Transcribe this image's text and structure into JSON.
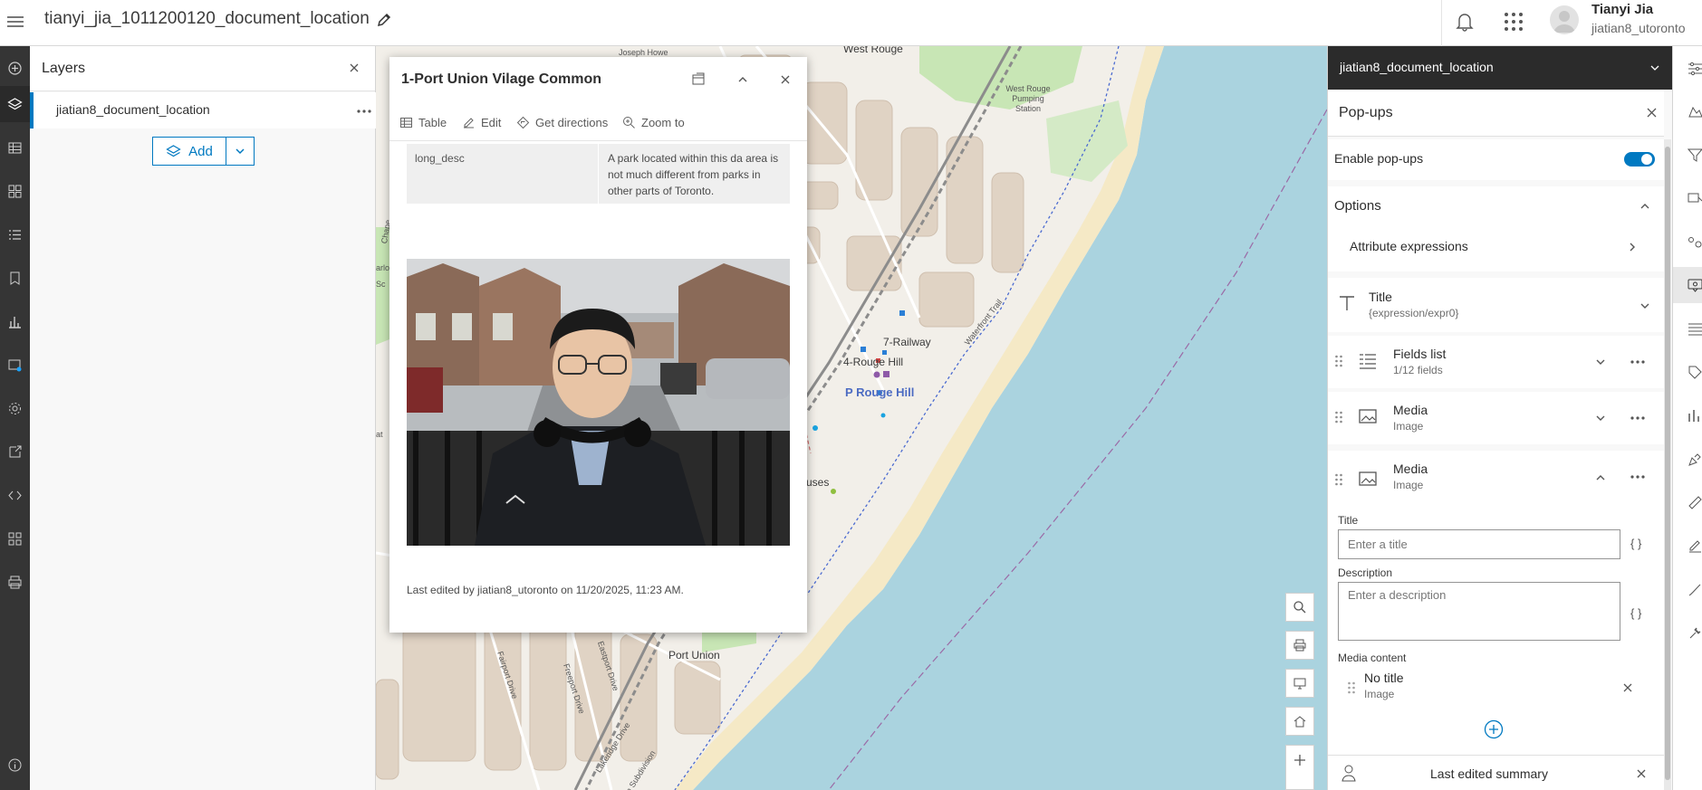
{
  "header": {
    "app_title": "tianyi_jia_1011200120_document_location",
    "user_name": "Tianyi Jia",
    "user_id": "jiatian8_utoronto"
  },
  "layers_panel": {
    "title": "Layers",
    "layer_name": "jiatian8_document_location",
    "add_label": "Add"
  },
  "map": {
    "labels": {
      "west_rouge": "West Rouge",
      "joseph_howe": "Joseph Howe",
      "pumping_station": "West Rouge Pumping Station",
      "railway": "7-Railway",
      "rouge_hill_stop": "4-Rouge Hill",
      "rouge_hill_station": "Rouge Hill",
      "waterfront_trail": "Waterfront Trail",
      "port_union": "Port Union",
      "fairport_drive": "Fairport Drive",
      "freeport_drive": "Freeport Drive",
      "eastport_drive": "Eastport Drive",
      "lakeridge_drive": "Lakeridge Drive",
      "subdivision": "ion Subdivision",
      "uses": "uses",
      "chapel": "Chape",
      "marlo": "arlo",
      "school": "Sc",
      "at": "at"
    }
  },
  "popup": {
    "title": "1-Port Union Vilage Common",
    "actions": {
      "table": "Table",
      "edit": "Edit",
      "directions": "Get directions",
      "zoom": "Zoom to"
    },
    "field_name": "long_desc",
    "field_value": "A park located within this da area is not much different from parks in other parts of Toronto.",
    "footer": "Last edited by jiatian8_utoronto on 11/20/2025, 11:23 AM."
  },
  "config_panel": {
    "layer_title": "jiatian8_document_location",
    "panel_title": "Pop-ups",
    "enable_label": "Enable pop-ups",
    "enabled": true,
    "options_label": "Options",
    "attr_expressions_label": "Attribute expressions",
    "title_block": {
      "title": "Title",
      "subtitle": "{expression/expr0}"
    },
    "fields_block": {
      "title": "Fields list",
      "subtitle": "1/12 fields"
    },
    "media_block_1": {
      "title": "Media",
      "subtitle": "Image"
    },
    "media_block_2": {
      "title": "Media",
      "subtitle": "Image"
    },
    "title_field_label": "Title",
    "title_placeholder": "Enter a title",
    "desc_field_label": "Description",
    "desc_placeholder": "Enter a description",
    "braces": "{ }",
    "media_content_label": "Media content",
    "media_item": {
      "title": "No title",
      "subtitle": "Image"
    },
    "last_edited_label": "Last edited summary"
  },
  "colors": {
    "accent": "#0079c1",
    "toolbar_dark": "#353535",
    "water": "#aad3df",
    "park": "#c8e6b5"
  }
}
